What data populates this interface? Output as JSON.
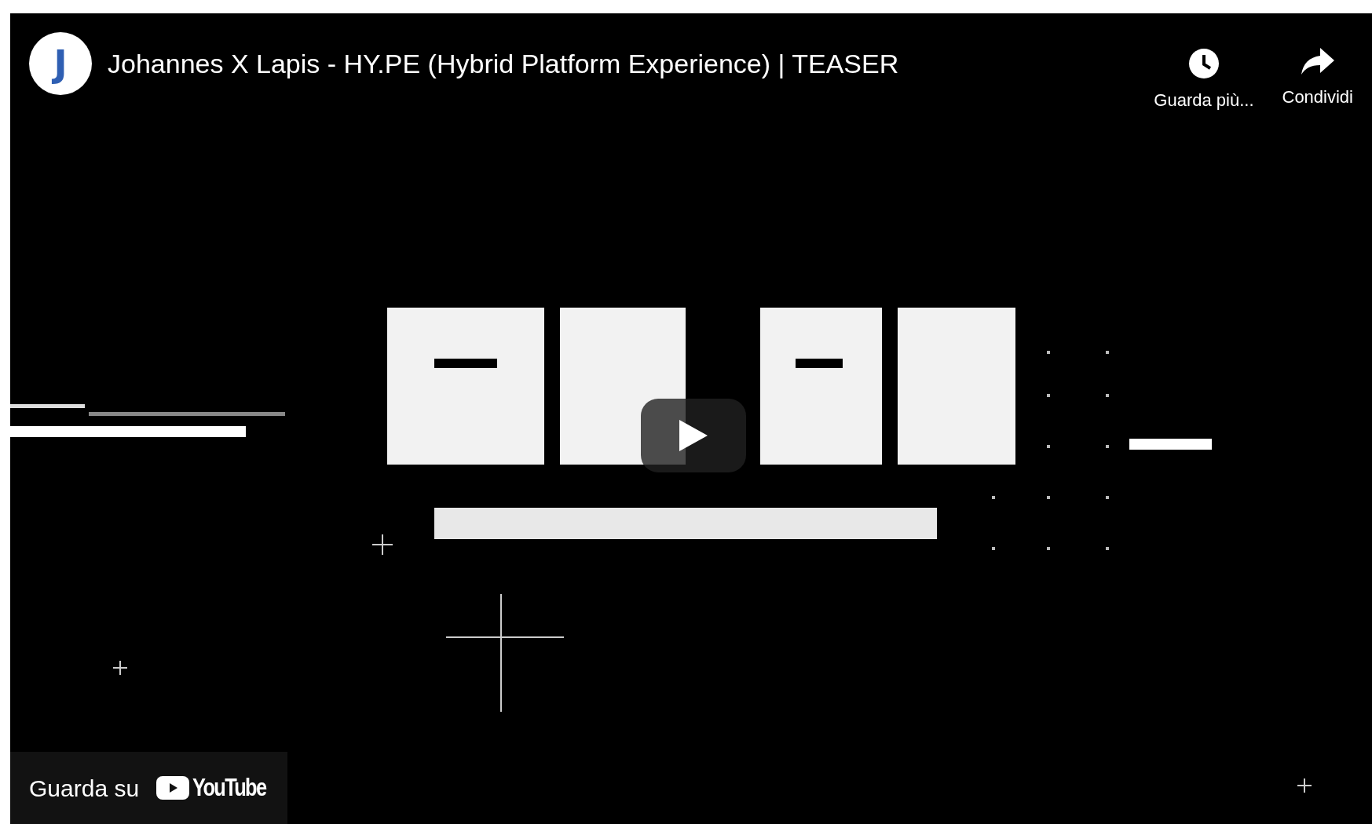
{
  "video": {
    "title": "Johannes X Lapis - HY.PE (Hybrid Platform Experience) | TEASER",
    "channel_avatar": {
      "letter": "J"
    },
    "actions": [
      {
        "kind": "watch_later",
        "label": "Guarda più..."
      },
      {
        "kind": "share",
        "label": "Condividi"
      }
    ],
    "watch_on": {
      "label": "Guarda su",
      "logo_text": "YouTube"
    }
  }
}
